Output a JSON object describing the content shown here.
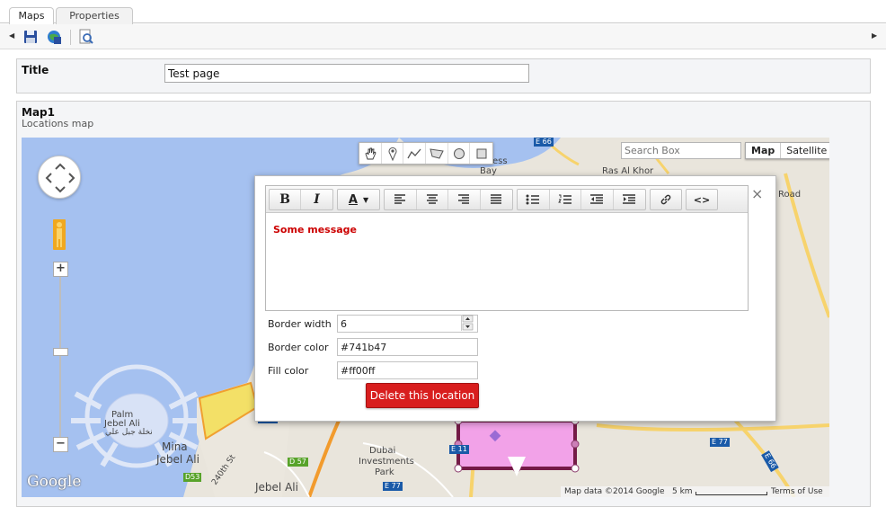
{
  "tabs": [
    {
      "label": "Maps",
      "active": true
    },
    {
      "label": "Properties",
      "active": false
    }
  ],
  "toolbar": {
    "icons": [
      "save-icon",
      "publish-icon",
      "preview-icon"
    ]
  },
  "title_field": {
    "label": "Title",
    "value": "Test page"
  },
  "map_field": {
    "label": "Map1",
    "sublabel": "Locations map"
  },
  "map": {
    "search_placeholder": "Search Box",
    "map_types": [
      "Map",
      "Satellite"
    ],
    "attribution": "Map data ©2014 Google",
    "scale": "5 km",
    "terms": "Terms of Use",
    "logo": "Google",
    "place_labels": {
      "palm1": "Palm",
      "palm2": "Jebel Ali",
      "palm_ar": "نخلة جبل علي",
      "mina1": "Mina",
      "mina2": "Jebel Ali",
      "jebel": "Jebel Ali",
      "park1": "Dubai",
      "park2": "Investments",
      "park3": "Park",
      "ras": "Ras Al Khor",
      "bay": "Bay",
      "road": "Road",
      "street": "240th St",
      "ess": "ess"
    },
    "road_shields": [
      "E 66",
      "E 11",
      "E 77",
      "E 77",
      "D 57",
      "D53",
      "E 11",
      "E 66"
    ],
    "zoom_in": "+",
    "zoom_out": "−",
    "polygon_fill": "#ff00ff",
    "polygon_border": "#741b47"
  },
  "infowindow": {
    "close": "×",
    "message": "Some message",
    "border_width_label": "Border width",
    "border_width_value": "6",
    "border_color_label": "Border color",
    "border_color_value": "#741b47",
    "fill_color_label": "Fill color",
    "fill_color_value": "#ff00ff",
    "delete_label": "Delete this location",
    "editor_buttons": {
      "bold": "B",
      "italic": "I",
      "font_color": "A",
      "code": "<>"
    }
  }
}
